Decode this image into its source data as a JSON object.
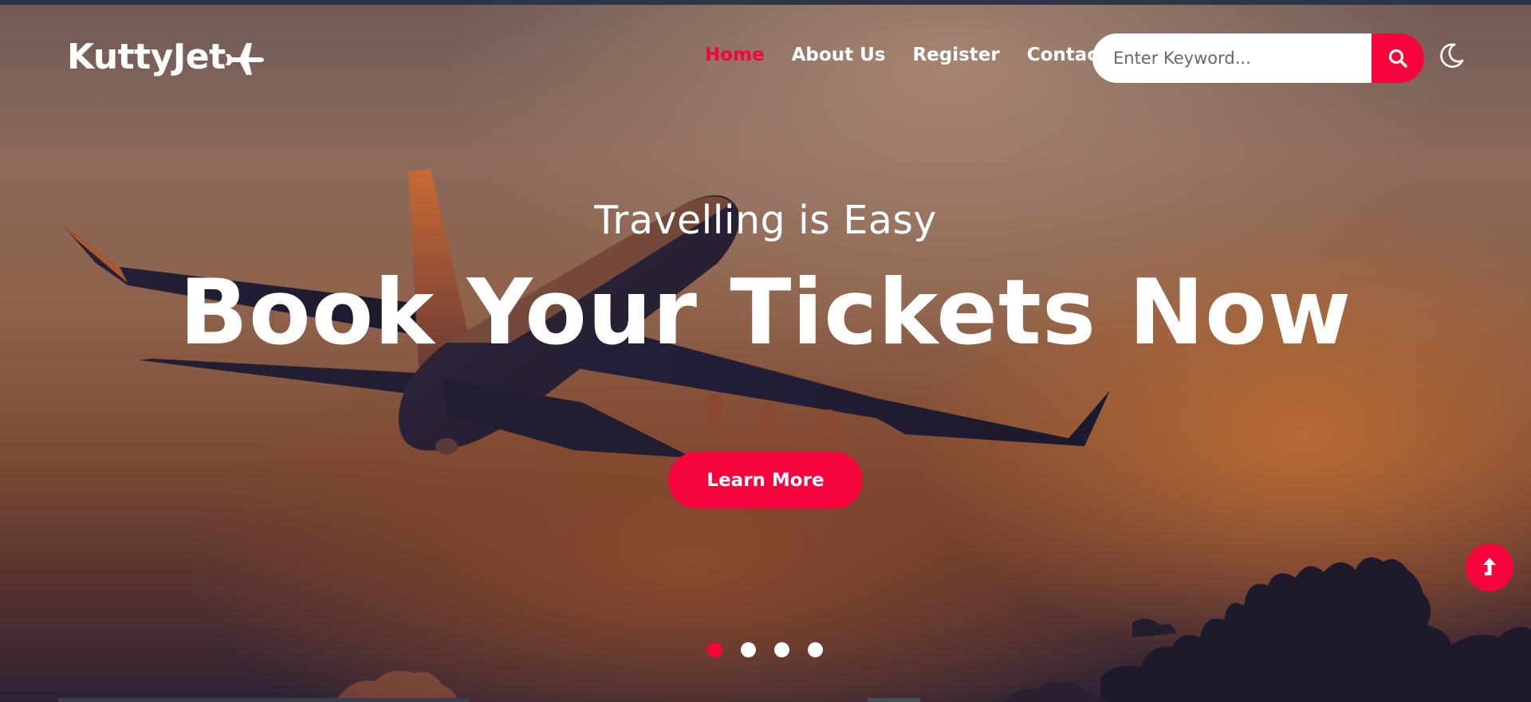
{
  "brand": {
    "name": "KuttyJet",
    "icon": "airplane-icon"
  },
  "nav": {
    "items": [
      {
        "label": "Home",
        "active": true
      },
      {
        "label": "About Us",
        "active": false
      },
      {
        "label": "Register",
        "active": false
      },
      {
        "label": "Contact",
        "active": false
      }
    ]
  },
  "search": {
    "placeholder": "Enter Keyword...",
    "value": "",
    "button_icon": "search-icon"
  },
  "theme_toggle": {
    "icon": "moon-icon"
  },
  "hero": {
    "subtitle": "Travelling is Easy",
    "headline": "Book Your Tickets Now",
    "cta_label": "Learn More"
  },
  "carousel": {
    "slide_count": 4,
    "active_index": 0
  },
  "scroll_top": {
    "icon": "arrow-up-icon"
  },
  "colors": {
    "accent": "#f5053c",
    "text": "#ffffff"
  }
}
